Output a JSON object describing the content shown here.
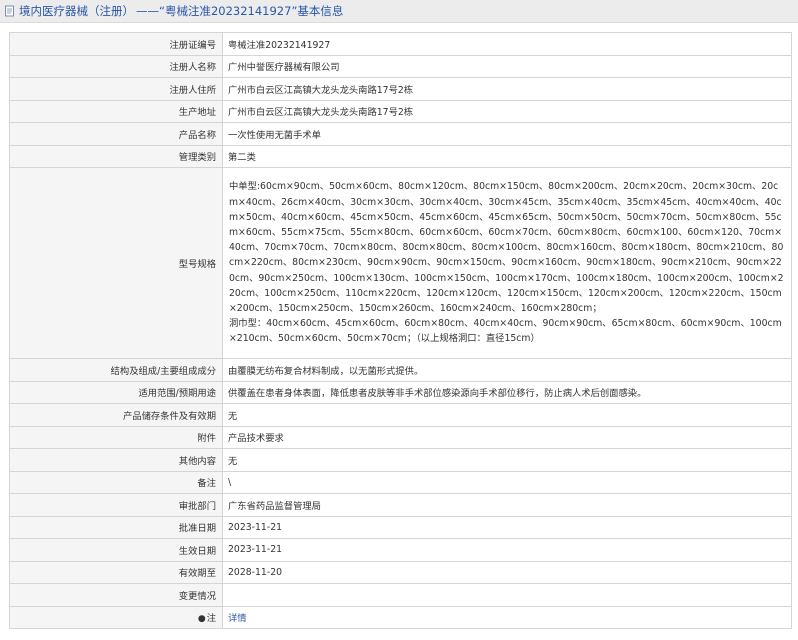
{
  "header": {
    "section": "境内医疗器械（注册）",
    "separator": "——",
    "title": "“粤械注准20232141927”基本信息"
  },
  "rows": [
    {
      "label": "注册证编号",
      "value": "粤械注准20232141927"
    },
    {
      "label": "注册人名称",
      "value": "广州中誉医疗器械有限公司"
    },
    {
      "label": "注册人住所",
      "value": "广州市白云区江高镇大龙头龙头南路17号2栋"
    },
    {
      "label": "生产地址",
      "value": "广州市白云区江高镇大龙头龙头南路17号2栋"
    },
    {
      "label": "产品名称",
      "value": "一次性使用无菌手术单"
    },
    {
      "label": "管理类别",
      "value": "第二类"
    },
    {
      "label": "型号规格",
      "value_line1": "中单型:60cm×90cm、50cm×60cm、80cm×120cm、80cm×150cm、80cm×200cm、20cm×20cm、20cm×30cm、20cm×40cm、26cm×40cm、30cm×30cm、30cm×40cm、30cm×45cm、35cm×40cm、35cm×45cm、40cm×40cm、40cm×50cm、40cm×60cm、45cm×50cm、45cm×60cm、45cm×65cm、50cm×50cm、50cm×70cm、50cm×80cm、55cm×60cm、55cm×75cm、55cm×80cm、60cm×60cm、60cm×70cm、60cm×80cm、60cm×100、60cm×120、70cm×40cm、70cm×70cm、70cm×80cm、80cm×80cm、80cm×100cm、80cm×160cm、80cm×180cm、80cm×210cm、80cm×220cm、80cm×230cm、90cm×90cm、90cm×150cm、90cm×160cm、90cm×180cm、90cm×210cm、90cm×220cm、90cm×250cm、100cm×130cm、100cm×150cm、100cm×170cm、100cm×180cm、100cm×200cm、100cm×220cm、100cm×250cm、110cm×220cm、120cm×120cm、120cm×150cm、120cm×200cm、120cm×220cm、150cm×200cm、150cm×250cm、150cm×260cm、160cm×240cm、160cm×280cm；",
      "value_line2": "洞巾型：40cm×60cm、45cm×60cm、60cm×80cm、40cm×40cm、90cm×90cm、65cm×80cm、60cm×90cm、100cm×210cm、50cm×60cm、50cm×70cm；（以上规格洞口：直径15cm）"
    },
    {
      "label": "结构及组成/主要组成成分",
      "value": "由覆膜无纺布复合材料制成，以无菌形式提供。"
    },
    {
      "label": "适用范围/预期用途",
      "value": "供覆盖在患者身体表面，降低患者皮肤等非手术部位感染源向手术部位移行，防止病人术后创面感染。"
    },
    {
      "label": "产品储存条件及有效期",
      "value": "无"
    },
    {
      "label": "附件",
      "value": "产品技术要求"
    },
    {
      "label": "其他内容",
      "value": "无"
    },
    {
      "label": "备注",
      "value": "\\"
    },
    {
      "label": "审批部门",
      "value": "广东省药品监督管理局"
    },
    {
      "label": "批准日期",
      "value": "2023-11-21"
    },
    {
      "label": "生效日期",
      "value": "2023-11-21"
    },
    {
      "label": "有效期至",
      "value": "2028-11-20"
    },
    {
      "label": "变更情况",
      "value": ""
    },
    {
      "label": "注",
      "value": "详情"
    }
  ],
  "icons": {
    "header": "document-icon",
    "note": "pin-icon"
  },
  "colors": {
    "link": "#2a56a6",
    "label_bg": "#f5f5f5",
    "border": "#d5d5d5"
  }
}
